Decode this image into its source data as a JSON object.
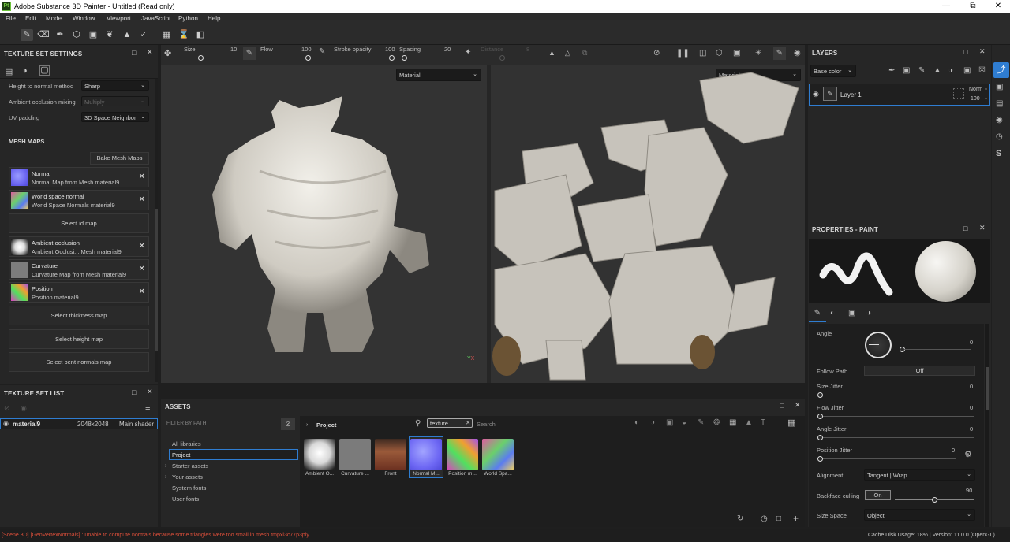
{
  "window": {
    "app_icon": "Pt",
    "title": "Adobe Substance 3D Painter - Untitled (Read only)"
  },
  "menu": [
    "File",
    "Edit",
    "Mode",
    "Window",
    "Viewport",
    "JavaScript",
    "Python",
    "Help"
  ],
  "texture_set_settings": {
    "title": "TEXTURE SET SETTINGS",
    "height_to_normal_label": "Height to normal method",
    "height_to_normal_value": "Sharp",
    "ao_mixing_label": "Ambient occlusion mixing",
    "ao_mixing_value": "Multiply",
    "uv_padding_label": "UV padding",
    "uv_padding_value": "3D Space Neighbor",
    "mesh_maps_title": "MESH MAPS",
    "bake_button": "Bake Mesh Maps",
    "maps": [
      {
        "name": "Normal",
        "desc": "Normal Map from Mesh material9"
      },
      {
        "name": "World space normal",
        "desc": "World Space Normals material9"
      },
      {
        "name": "Ambient occlusion",
        "desc": "Ambient Occlusi... Mesh material9"
      },
      {
        "name": "Curvature",
        "desc": "Curvature Map from Mesh material9"
      },
      {
        "name": "Position",
        "desc": "Position material9"
      }
    ],
    "select_id": "Select id map",
    "select_thickness": "Select thickness map",
    "select_height": "Select height map",
    "select_bent": "Select bent normals map"
  },
  "texture_set_list": {
    "title": "TEXTURE SET LIST",
    "row": {
      "name": "material9",
      "size": "2048x2048",
      "shader": "Main shader"
    }
  },
  "tool_props": {
    "size_label": "Size",
    "size_value": "10",
    "flow_label": "Flow",
    "flow_value": "100",
    "stroke_opacity_label": "Stroke opacity",
    "stroke_opacity_value": "100",
    "spacing_label": "Spacing",
    "spacing_value": "20",
    "distance_label": "Distance",
    "distance_value": "8"
  },
  "viewport": {
    "left_mode": "Material",
    "right_mode": "Material"
  },
  "assets": {
    "title": "ASSETS",
    "filter_label": "FILTER BY PATH",
    "tree": [
      "All libraries",
      "Project",
      "Starter assets",
      "Your assets",
      "System fonts",
      "User fonts"
    ],
    "breadcrumb": "Project",
    "search_tag": "texture",
    "search_placeholder": "Search",
    "items": [
      "Ambient O...",
      "Curvature ...",
      "Front",
      "Normal M...",
      "Position m...",
      "World Spa..."
    ]
  },
  "layers": {
    "title": "LAYERS",
    "channel": "Base color",
    "layer_name": "Layer 1",
    "blend_mode": "Norm",
    "opacity": "100"
  },
  "properties": {
    "title": "PROPERTIES - PAINT",
    "angle_label": "Angle",
    "angle_value": "0",
    "follow_path_label": "Follow Path",
    "follow_path_value": "Off",
    "size_jitter_label": "Size Jitter",
    "size_jitter_value": "0",
    "flow_jitter_label": "Flow Jitter",
    "flow_jitter_value": "0",
    "angle_jitter_label": "Angle Jitter",
    "angle_jitter_value": "0",
    "position_jitter_label": "Position Jitter",
    "position_jitter_value": "0",
    "alignment_label": "Alignment",
    "alignment_value": "Tangent | Wrap",
    "backface_label": "Backface culling",
    "backface_toggle": "On",
    "backface_value": "90",
    "size_space_label": "Size Space",
    "size_space_value": "Object"
  },
  "status": {
    "error": "[Scene 3D] [GenVertexNormals] : unable to compute normals because some triangles were too small in mesh tmpxl3c77p3ply",
    "right": "Cache Disk Usage:   18% | Version: 11.0.0 (OpenGL)"
  },
  "axis_labels": {
    "y": "Y",
    "x": "X"
  },
  "colors": {
    "accent": "#2f7dd1",
    "error": "#e0503b",
    "panel": "#262626"
  }
}
